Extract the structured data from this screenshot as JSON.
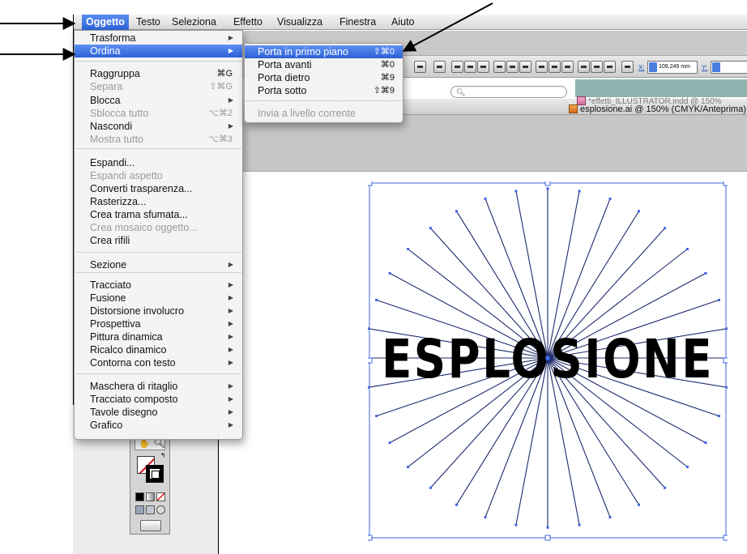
{
  "menubar": {
    "items": [
      {
        "label": "Oggetto",
        "active": true
      },
      {
        "label": "Testo"
      },
      {
        "label": "Seleziona"
      },
      {
        "label": "Effetto"
      },
      {
        "label": "Visualizza"
      },
      {
        "label": "Finestra"
      },
      {
        "label": "Aiuto"
      }
    ]
  },
  "object_menu": {
    "items": [
      {
        "label": "Trasforma",
        "submenu": true
      },
      {
        "label": "Ordina",
        "submenu": true,
        "highlighted": true
      },
      {
        "label": "Raggruppa",
        "shortcut": "⌘G"
      },
      {
        "label": "Separa",
        "shortcut": "⇧⌘G",
        "disabled": true
      },
      {
        "label": "Blocca",
        "submenu": true
      },
      {
        "label": "Sblocca tutto",
        "shortcut": "⌥⌘2",
        "disabled": true
      },
      {
        "label": "Nascondi",
        "submenu": true
      },
      {
        "label": "Mostra tutto",
        "shortcut": "⌥⌘3",
        "disabled": true
      },
      {
        "label": "Espandi..."
      },
      {
        "label": "Espandi aspetto",
        "disabled": true
      },
      {
        "label": "Converti trasparenza..."
      },
      {
        "label": "Rasterizza..."
      },
      {
        "label": "Crea trama sfumata..."
      },
      {
        "label": "Crea mosaico oggetto...",
        "disabled": true
      },
      {
        "label": "Crea rifili"
      },
      {
        "label": "Sezione",
        "submenu": true
      },
      {
        "label": "Tracciato",
        "submenu": true
      },
      {
        "label": "Fusione",
        "submenu": true
      },
      {
        "label": "Distorsione involucro",
        "submenu": true
      },
      {
        "label": "Prospettiva",
        "submenu": true
      },
      {
        "label": "Pittura dinamica",
        "submenu": true
      },
      {
        "label": "Ricalco dinamico",
        "submenu": true
      },
      {
        "label": "Contorna con testo",
        "submenu": true
      },
      {
        "label": "Maschera di ritaglio",
        "submenu": true
      },
      {
        "label": "Tracciato composto",
        "submenu": true
      },
      {
        "label": "Tavole disegno",
        "submenu": true
      },
      {
        "label": "Grafico",
        "submenu": true
      }
    ]
  },
  "arrange_submenu": {
    "items": [
      {
        "label": "Porta in primo piano",
        "shortcut": "⇧⌘0",
        "highlighted": true
      },
      {
        "label": "Porta avanti",
        "shortcut": "⌘0"
      },
      {
        "label": "Porta dietro",
        "shortcut": "⌘9"
      },
      {
        "label": "Porta sotto",
        "shortcut": "⇧⌘9"
      },
      {
        "label": "Invia a livello corrente",
        "disabled": true
      }
    ]
  },
  "control_bar": {
    "x_label": "X:",
    "x_value": "109,249 mm",
    "y_label": "Y:"
  },
  "documents": {
    "back_tab": "*effetti_ILLUSTRATOR.indd @ 150%",
    "front_tab": "esplosione.ai @ 150% (CMYK/Anteprima)"
  },
  "artwork": {
    "text": "ESPLOSIONE",
    "ray_count": 36,
    "colors": {
      "ray": "#1c2a6a",
      "selection": "#3d64e0",
      "text": "#000000"
    }
  },
  "colors": {
    "menu_highlight": "#2f63d8",
    "menubar_bg": "#e4e4e4",
    "annotation_arrow": "#000000"
  },
  "annotations": {
    "arrow_count": 3
  }
}
